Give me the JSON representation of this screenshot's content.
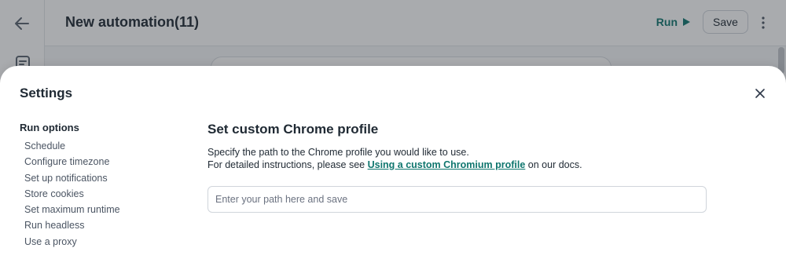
{
  "app": {
    "title": "New automation(11)",
    "run_label": "Run",
    "save_label": "Save",
    "accent_color": "#0f766e"
  },
  "settings": {
    "title": "Settings",
    "nav_heading": "Run options",
    "nav_items": [
      "Schedule",
      "Configure timezone",
      "Set up notifications",
      "Store cookies",
      "Set maximum runtime",
      "Run headless",
      "Use a proxy"
    ],
    "section": {
      "title": "Set custom Chrome profile",
      "desc_line1": "Specify the path to the Chrome profile you would like to use.",
      "desc_line2_prefix": "For detailed instructions, please see ",
      "desc_link": "Using a custom Chromium profile",
      "desc_line2_suffix": " on our docs.",
      "input_value": "",
      "input_placeholder": "Enter your path here and save"
    }
  }
}
